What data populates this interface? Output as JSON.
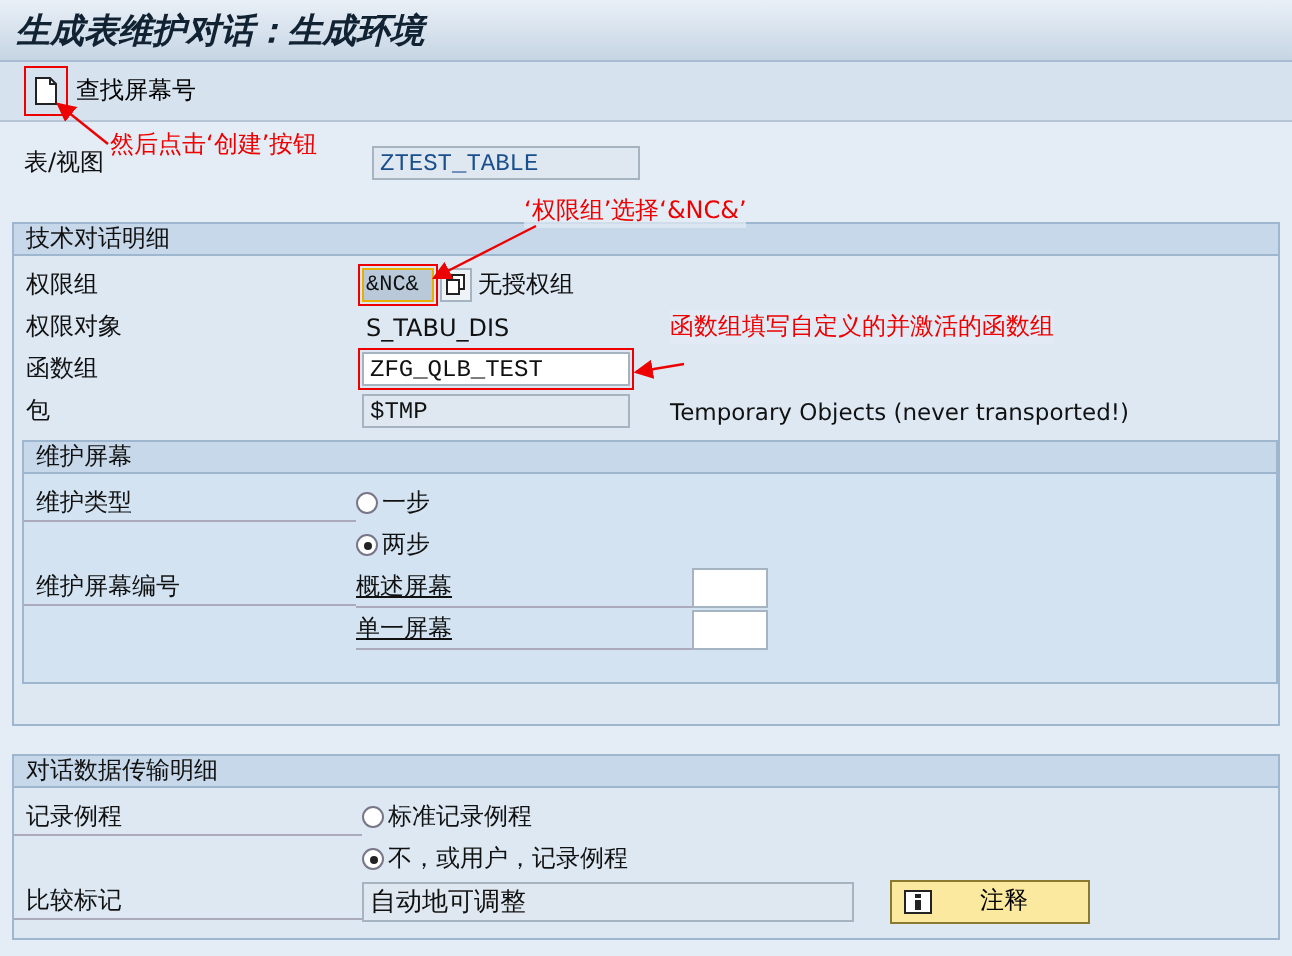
{
  "window": {
    "title": "生成表维护对话：生成环境"
  },
  "toolbar": {
    "find_button": "查找屏幕号"
  },
  "table_view": {
    "label": "表/视图",
    "value": "ZTEST_TABLE"
  },
  "tech_group": {
    "title": "技术对话明细",
    "auth_group": {
      "label": "权限组",
      "value": "&NC&",
      "description": "无授权组"
    },
    "auth_object": {
      "label": "权限对象",
      "value": "S_TABU_DIS"
    },
    "function_group": {
      "label": "函数组",
      "value": "ZFG_QLB_TEST"
    },
    "package": {
      "label": "包",
      "value": "$TMP",
      "description": "Temporary Objects (never transported!)"
    },
    "screen_group": {
      "title": "维护屏幕",
      "type_label": "维护类型",
      "options": [
        {
          "label": "一步",
          "selected": false
        },
        {
          "label": "两步",
          "selected": true
        }
      ],
      "number_label": "维护屏幕编号",
      "screens": [
        {
          "label": "概述屏幕"
        },
        {
          "label": "单一屏幕"
        }
      ]
    }
  },
  "transfer_group": {
    "title": "对话数据传输明细",
    "routine_label": "记录例程",
    "options": [
      {
        "label": "标准记录例程",
        "selected": false
      },
      {
        "label": "不，或用户，记录例程",
        "selected": true
      }
    ],
    "compare_label": "比较标记",
    "compare_value": "自动地可调整",
    "note_button": "注释"
  },
  "annotations": [
    {
      "text": "然后点击‘创建’按钮"
    },
    {
      "text": "‘权限组’选择‘&NC&’"
    },
    {
      "text": "函数组填写自定义的并激活的函数组"
    }
  ]
}
